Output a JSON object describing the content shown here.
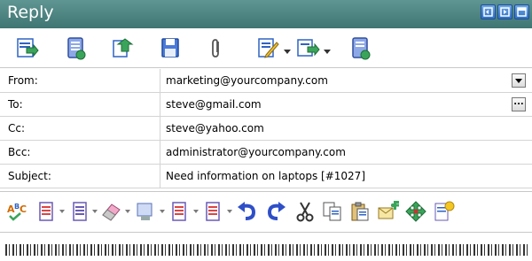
{
  "window": {
    "title": "Reply"
  },
  "title_buttons": [
    {
      "icon": "restore-down-icon"
    },
    {
      "icon": "minimize-window-icon"
    },
    {
      "icon": "maximize-window-icon"
    }
  ],
  "toolbar1": [
    {
      "icon": "send-icon"
    },
    {
      "icon": "save-draft-icon"
    },
    {
      "icon": "send-later-icon"
    },
    {
      "icon": "save-disk-icon"
    },
    {
      "icon": "paperclip-icon"
    },
    {
      "icon": "signature-icon"
    },
    {
      "icon": "insert-template-icon"
    },
    {
      "icon": "address-book-icon"
    }
  ],
  "form": {
    "from": {
      "label": "From:",
      "value": "marketing@yourcompany.com"
    },
    "to": {
      "label": "To:",
      "value": "steve@gmail.com",
      "browse": "..."
    },
    "cc": {
      "label": "Cc:",
      "value": "steve@yahoo.com"
    },
    "bcc": {
      "label": "Bcc:",
      "value": "administrator@yourcompany.com"
    },
    "subject": {
      "label": "Subject:",
      "value": "Need information on laptops [#1027]"
    }
  },
  "toolbar2": [
    {
      "icon": "spellcheck-icon"
    },
    {
      "icon": "paragraph-style-icon"
    },
    {
      "icon": "font-style-icon"
    },
    {
      "icon": "eraser-icon"
    },
    {
      "icon": "insert-image-icon"
    },
    {
      "icon": "list-icon"
    },
    {
      "icon": "table-icon"
    },
    {
      "icon": "undo-icon"
    },
    {
      "icon": "redo-icon"
    },
    {
      "icon": "cut-icon"
    },
    {
      "icon": "copy-icon"
    },
    {
      "icon": "paste-icon"
    },
    {
      "icon": "insert-link-icon"
    },
    {
      "icon": "navigate-icon"
    },
    {
      "icon": "new-note-icon"
    }
  ],
  "colors": {
    "titlebar": "#4f8582",
    "title_text": "#ffffff",
    "accent_blue": "#2f6fc6",
    "icon_green": "#3aa55a",
    "icon_blue": "#2f63c4",
    "icon_purple": "#6a5ab5",
    "border": "#d4d4d4"
  }
}
